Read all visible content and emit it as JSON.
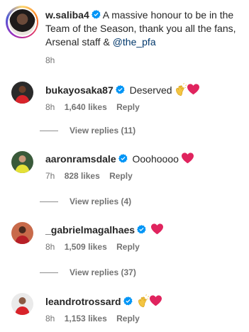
{
  "post": {
    "username": "w.saliba4",
    "caption": "A massive honour to be in the Team of the Season, thank you all the fans, Arsenal staff & ",
    "mention": "@the_pfa",
    "time": "8h"
  },
  "comments": [
    {
      "username": "bukayosaka87",
      "text": "Deserved",
      "time": "8h",
      "likes": "1,640 likes",
      "reply": "Reply",
      "view_replies": "View replies (11)",
      "emoji": [
        "clap-icon",
        "heart-icon"
      ]
    },
    {
      "username": "aaronramsdale",
      "text": "Ooohoooo",
      "time": "7h",
      "likes": "828 likes",
      "reply": "Reply",
      "view_replies": "View replies (4)",
      "emoji": [
        "heart-icon"
      ]
    },
    {
      "username": "_gabrielmagalhaes",
      "text": "",
      "time": "8h",
      "likes": "1,509 likes",
      "reply": "Reply",
      "view_replies": "View replies (37)",
      "emoji": [
        "heart-icon"
      ]
    },
    {
      "username": "leandrotrossard",
      "text": "",
      "time": "8h",
      "likes": "1,153 likes",
      "reply": "Reply",
      "emoji": [
        "clap-icon",
        "heart-icon"
      ]
    }
  ],
  "colors": {
    "verified": "#0095f6",
    "heart": "#e0245e",
    "mention": "#00376b",
    "meta": "#737373"
  }
}
